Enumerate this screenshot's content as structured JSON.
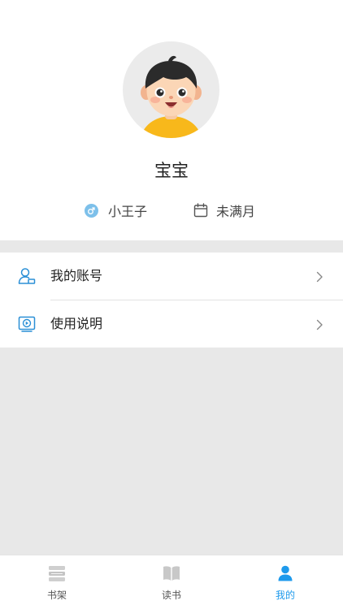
{
  "profile": {
    "nickname": "宝宝",
    "gender_label": "小王子",
    "gender_icon": "male-icon",
    "age_label": "未满月",
    "age_icon": "calendar-icon"
  },
  "menu": {
    "items": [
      {
        "label": "我的账号",
        "icon": "account-icon"
      },
      {
        "label": "使用说明",
        "icon": "video-guide-icon"
      }
    ]
  },
  "tabbar": {
    "tabs": [
      {
        "label": "书架",
        "icon": "bookshelf-icon",
        "active": false
      },
      {
        "label": "读书",
        "icon": "book-icon",
        "active": false
      },
      {
        "label": "我的",
        "icon": "user-icon",
        "active": true
      }
    ]
  },
  "colors": {
    "accent": "#1e9aec",
    "background": "#e8e8e8",
    "gender_badge": "#7dc0ea"
  }
}
